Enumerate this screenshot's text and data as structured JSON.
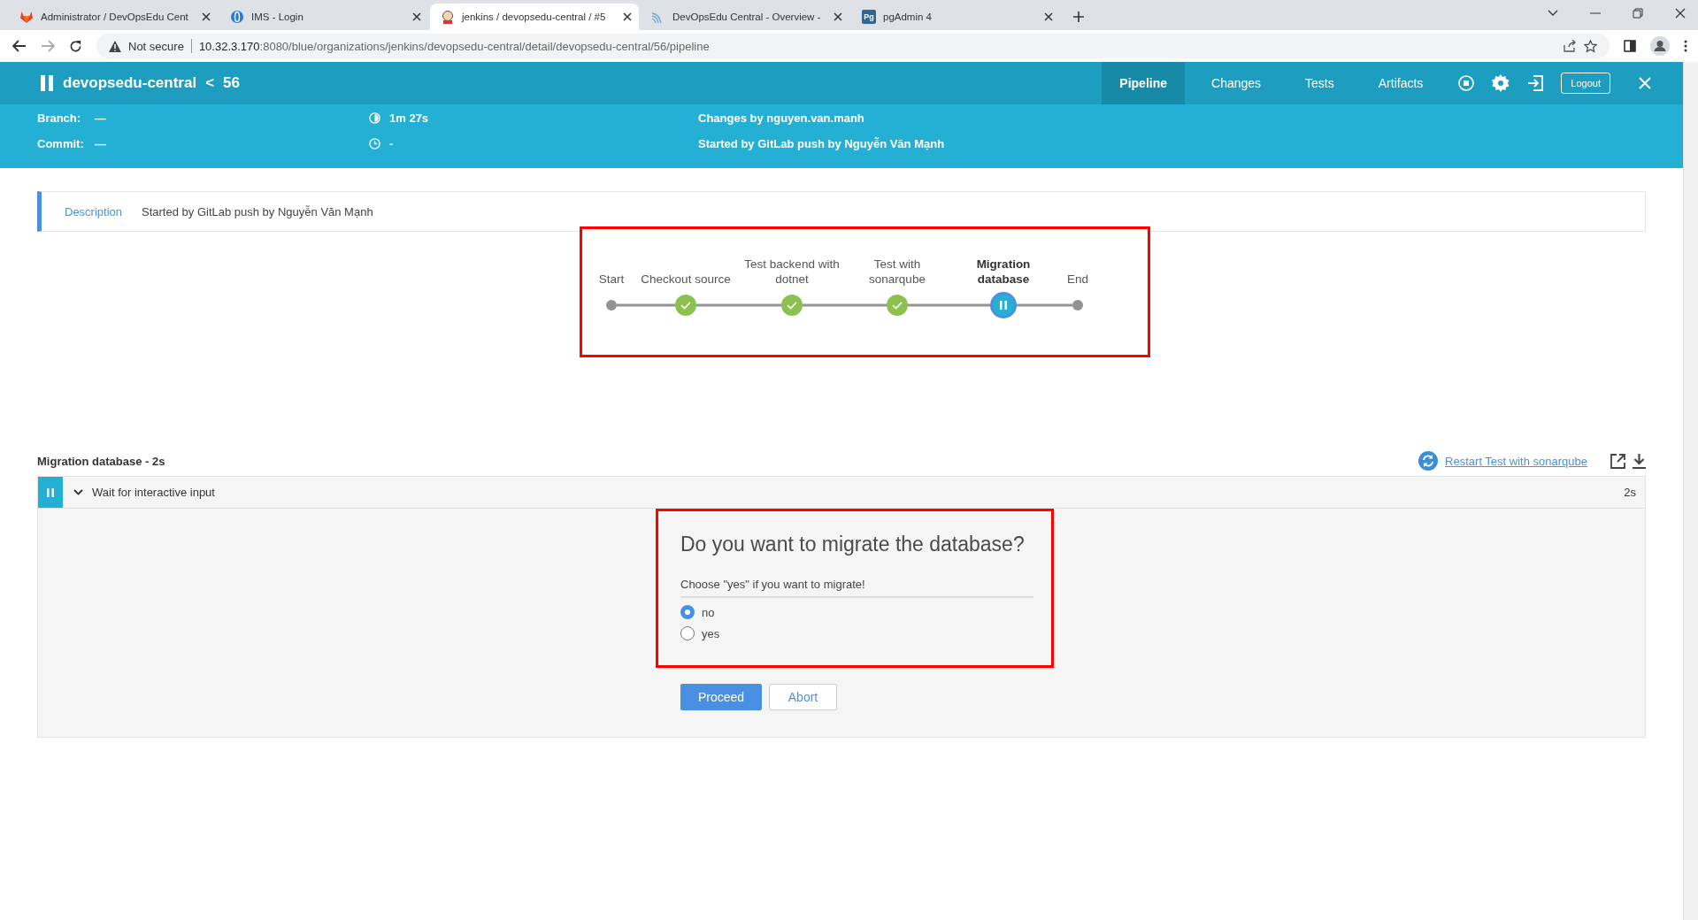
{
  "browser": {
    "tabs": [
      {
        "title": "Administrator / DevOpsEdu Cent",
        "kind": "gitlab",
        "selected": false
      },
      {
        "title": "IMS - Login",
        "kind": "ims",
        "selected": false
      },
      {
        "title": "jenkins / devopsedu-central / #5",
        "kind": "jenkins",
        "selected": true
      },
      {
        "title": "DevOpsEdu Central - Overview -",
        "kind": "wave",
        "selected": false
      },
      {
        "title": "pgAdmin 4",
        "kind": "pg",
        "icon_text": "Pg",
        "selected": false
      }
    ],
    "security": "Not secure",
    "url_host": "10.32.3.170",
    "url_rest": ":8080/blue/organizations/jenkins/devopsedu-central/detail/devopsedu-central/56/pipeline"
  },
  "header": {
    "paused": true,
    "title": "devopsedu-central",
    "separator": "<",
    "run": "56",
    "nav": [
      {
        "label": "Pipeline",
        "selected": true
      },
      {
        "label": "Changes",
        "selected": false
      },
      {
        "label": "Tests",
        "selected": false
      },
      {
        "label": "Artifacts",
        "selected": false
      }
    ],
    "logout": "Logout"
  },
  "info": {
    "branch_label": "Branch:",
    "branch": "—",
    "commit_label": "Commit:",
    "commit": "—",
    "duration": "1m 27s",
    "time": "-",
    "changes": "Changes by nguyen.van.manh",
    "started": "Started by GitLab push by Nguyễn Văn Mạnh"
  },
  "description": {
    "label": "Description",
    "text": "Started by GitLab push by Nguyễn Văn Mạnh"
  },
  "stages": [
    {
      "kind": "start",
      "lines": [
        "Start"
      ],
      "selected": false
    },
    {
      "kind": "success",
      "lines": [
        "Checkout source"
      ],
      "selected": false
    },
    {
      "kind": "success",
      "lines": [
        "Test backend with",
        "dotnet"
      ],
      "selected": false
    },
    {
      "kind": "success",
      "lines": [
        "Test with",
        "sonarqube"
      ],
      "selected": false
    },
    {
      "kind": "paused",
      "lines": [
        "Migration",
        "database"
      ],
      "selected": true
    },
    {
      "kind": "end",
      "lines": [
        "End"
      ],
      "selected": false
    }
  ],
  "step": {
    "title": "Migration database - 2s",
    "restart": "Restart Test with sonarqube",
    "log": {
      "paused": true,
      "expanded": true,
      "label": "Wait for interactive input",
      "duration": "2s"
    },
    "input": {
      "question": "Do you want to migrate the database?",
      "description": "Choose \"yes\" if you want to migrate!",
      "options": [
        {
          "label": "no",
          "selected": true
        },
        {
          "label": "yes",
          "selected": false
        }
      ],
      "proceed": "Proceed",
      "abort": "Abort"
    }
  }
}
